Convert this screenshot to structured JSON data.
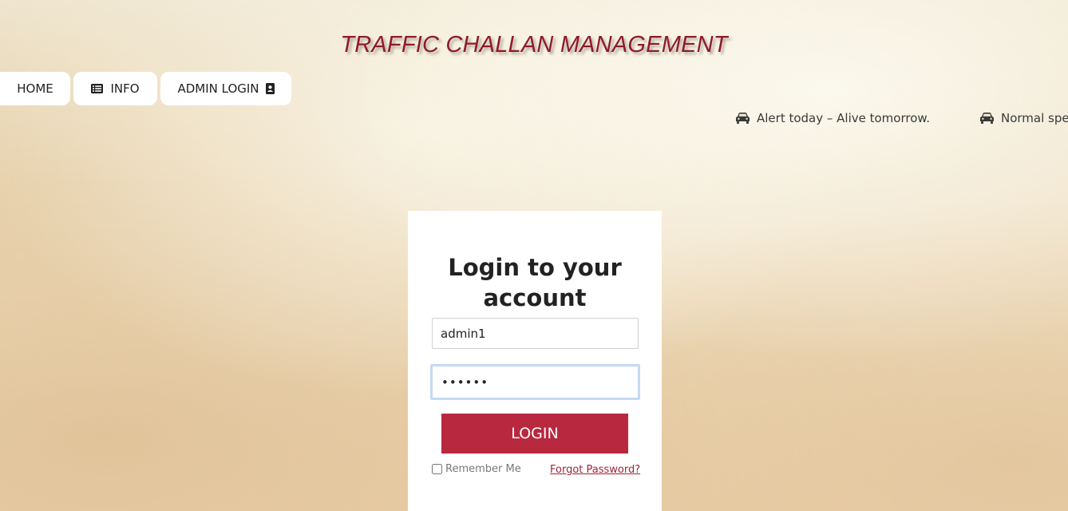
{
  "header": {
    "title": "TRAFFIC CHALLAN MANAGEMENT"
  },
  "nav": {
    "home_label": "HOME",
    "info_label": "INFO",
    "admin_login_label": "ADMIN LOGIN",
    "info_icon": "list-icon",
    "admin_icon": "contact-card-icon"
  },
  "ticker": {
    "items": [
      {
        "icon": "car-icon",
        "text": "Alert today – Alive tomorrow."
      },
      {
        "icon": "car-icon",
        "text": "Normal spe"
      }
    ]
  },
  "login_card": {
    "title_line1": "Login to your",
    "title_line2": "account",
    "username_value": "admin1",
    "password_value": "••••••",
    "login_button_label": "LOGIN",
    "remember_label": "Remember Me",
    "remember_checked": false,
    "forgot_label": "Forgot Password?"
  },
  "colors": {
    "title": "#8e1b2b",
    "login_button": "#b8283f",
    "link": "#a02338",
    "focus_ring": "#c4d9f5"
  }
}
